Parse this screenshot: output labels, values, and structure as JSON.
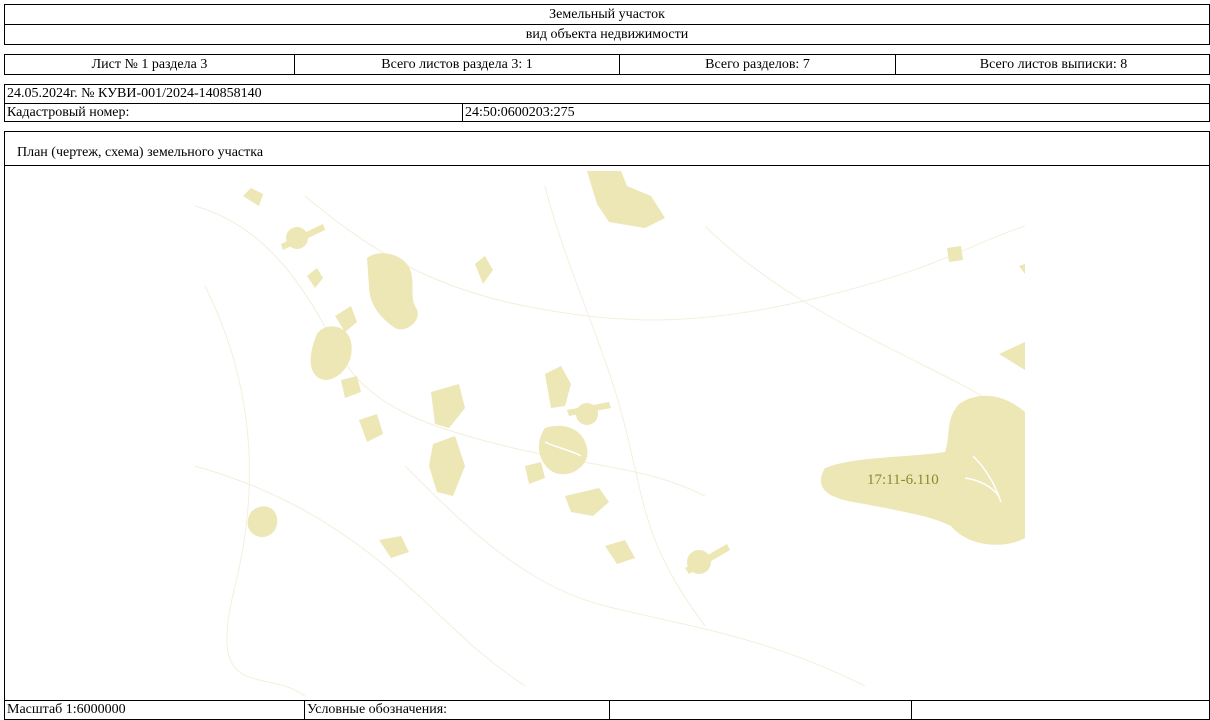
{
  "header": {
    "title": "Земельный участок",
    "subtitle": "вид объекта недвижимости"
  },
  "sheet_info": {
    "sheet": "Лист № 1 раздела 3",
    "total_sheets_section": "Всего листов раздела 3: 1",
    "total_sections": "Всего разделов: 7",
    "total_sheets_extract": "Всего листов выписки: 8"
  },
  "document": {
    "date_number": "24.05.2024г. № КУВИ-001/2024-140858140",
    "cadastral_label": "Кадастровый номер:",
    "cadastral_number": "24:50:0600203:275"
  },
  "plan": {
    "title": "План (чертеж, схема) земельного участка",
    "map_label": "17:11-6.110",
    "colors": {
      "land": "#ede6b5",
      "label": "#8a8a2e",
      "line": "#f2eed8"
    }
  },
  "footer": {
    "scale": "Масштаб 1:6000000",
    "legend_label": "Условные обозначения:"
  }
}
